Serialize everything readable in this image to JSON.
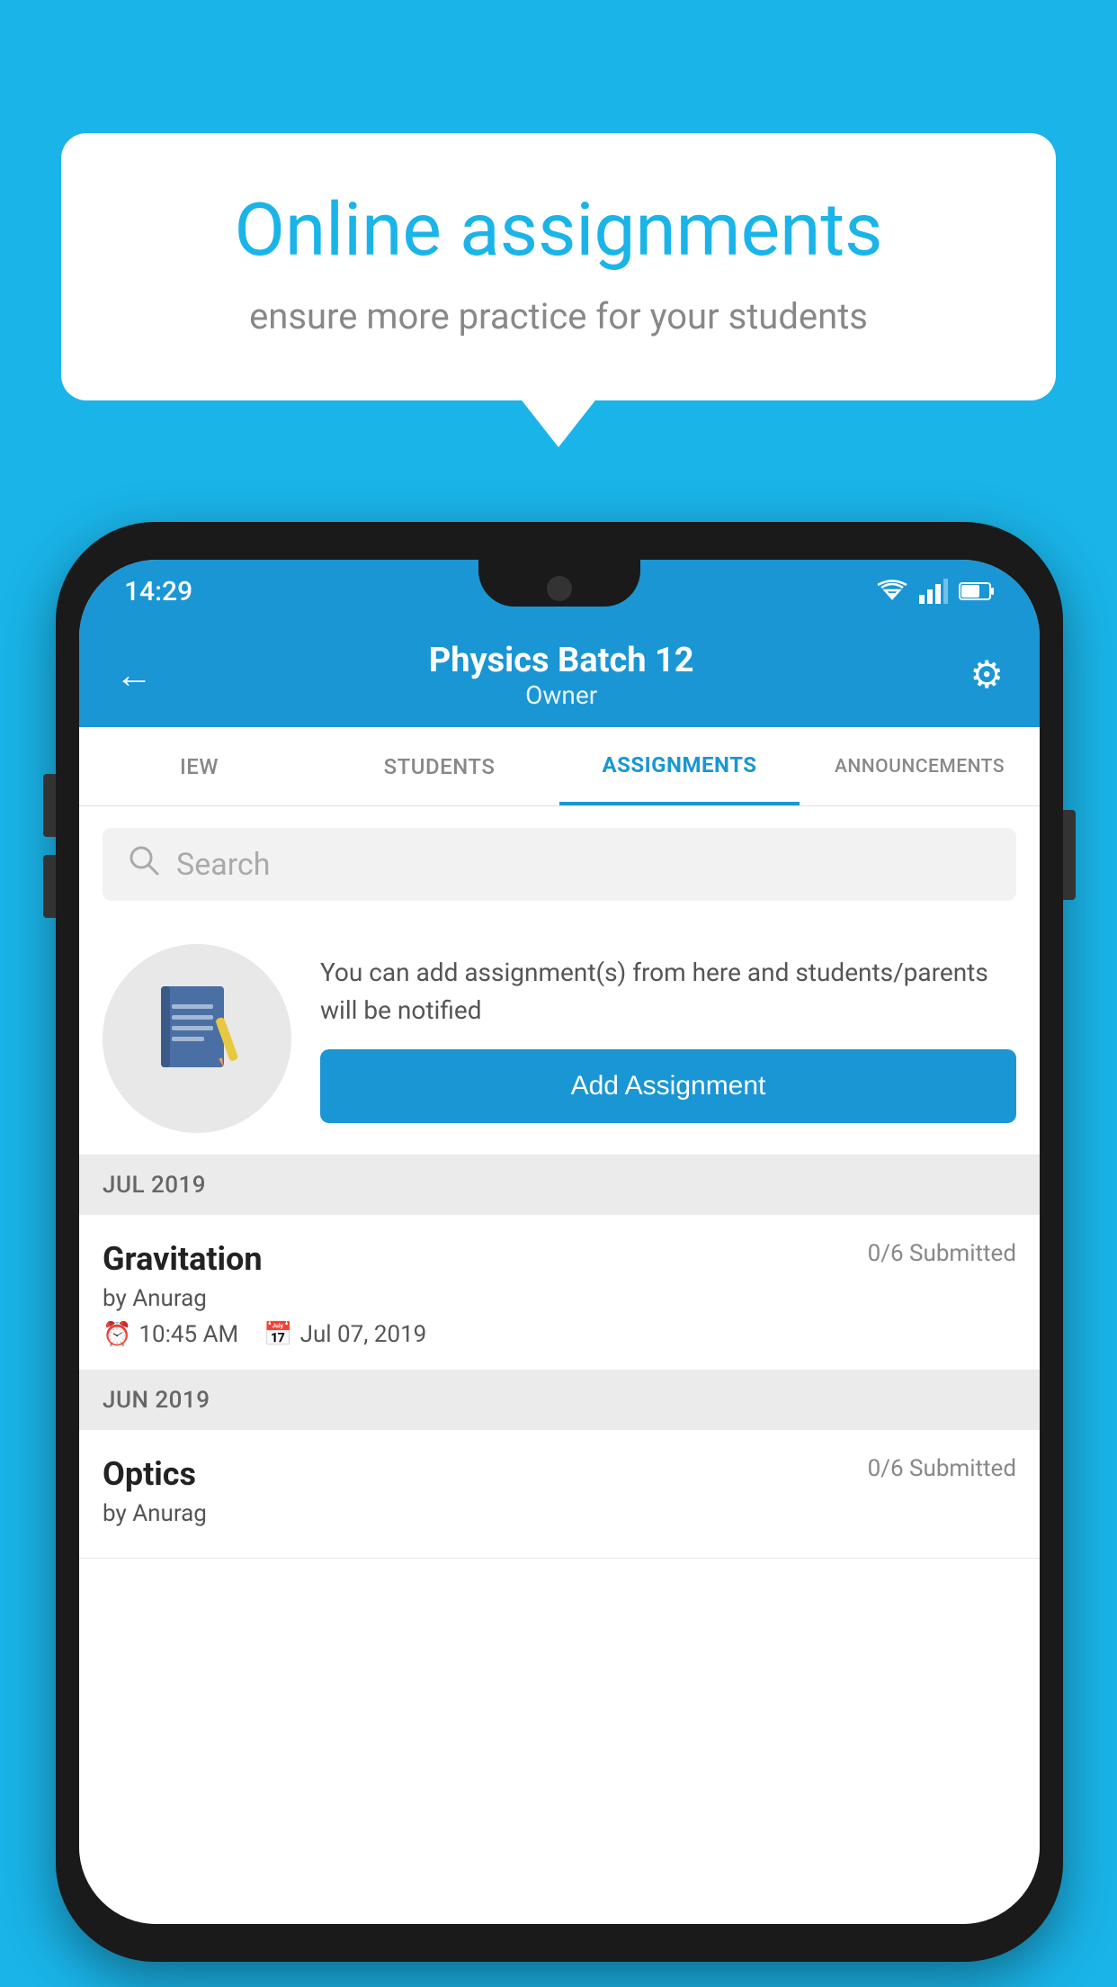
{
  "background": {
    "color": "#1ab4e8"
  },
  "speech_bubble": {
    "title": "Online assignments",
    "subtitle": "ensure more practice for your students"
  },
  "status_bar": {
    "time": "14:29",
    "wifi": "wifi",
    "signal": "signal",
    "battery": "battery"
  },
  "app_header": {
    "back_label": "←",
    "title": "Physics Batch 12",
    "subtitle": "Owner",
    "settings_label": "⚙"
  },
  "tabs": {
    "items": [
      {
        "label": "IEW",
        "active": false
      },
      {
        "label": "STUDENTS",
        "active": false
      },
      {
        "label": "ASSIGNMENTS",
        "active": true
      },
      {
        "label": "ANNOUNCEMENTS",
        "active": false
      }
    ]
  },
  "search": {
    "placeholder": "Search"
  },
  "empty_state": {
    "description": "You can add assignment(s) from here and students/parents will be notified",
    "add_button_label": "Add Assignment"
  },
  "sections": [
    {
      "header": "JUL 2019",
      "assignments": [
        {
          "title": "Gravitation",
          "submitted": "0/6 Submitted",
          "by": "by Anurag",
          "time": "10:45 AM",
          "date": "Jul 07, 2019"
        }
      ]
    },
    {
      "header": "JUN 2019",
      "assignments": [
        {
          "title": "Optics",
          "submitted": "0/6 Submitted",
          "by": "by Anurag",
          "time": "",
          "date": ""
        }
      ]
    }
  ]
}
